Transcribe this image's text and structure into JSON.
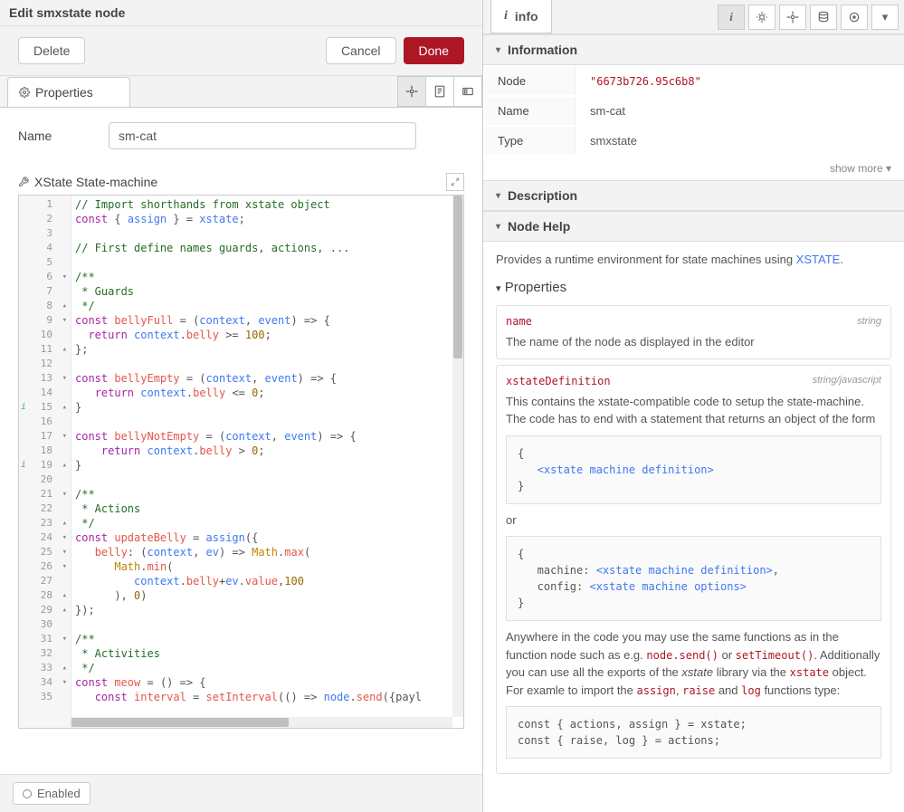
{
  "left": {
    "title": "Edit smxstate node",
    "delete_label": "Delete",
    "cancel_label": "Cancel",
    "done_label": "Done",
    "tab_label": "Properties",
    "name_label": "Name",
    "name_value": "sm-cat",
    "section_label": "XState State-machine",
    "enabled_label": "Enabled"
  },
  "code": {
    "lines": [
      {
        "n": 1,
        "fold": "",
        "text": "// Import shorthands from xstate object",
        "cls": "comment"
      },
      {
        "n": 2,
        "fold": "",
        "text": "const { assign } = xstate;"
      },
      {
        "n": 3,
        "fold": "",
        "text": ""
      },
      {
        "n": 4,
        "fold": "",
        "text": "// First define names guards, actions, ...",
        "cls": "comment"
      },
      {
        "n": 5,
        "fold": "",
        "text": ""
      },
      {
        "n": 6,
        "fold": "▾",
        "text": "/**",
        "cls": "comment"
      },
      {
        "n": 7,
        "fold": "",
        "text": " * Guards",
        "cls": "comment"
      },
      {
        "n": 8,
        "fold": "▴",
        "text": " */",
        "cls": "comment"
      },
      {
        "n": 9,
        "fold": "▾",
        "text": "const bellyFull = (context, event) => {"
      },
      {
        "n": 10,
        "fold": "",
        "text": "  return context.belly >= 100;"
      },
      {
        "n": 11,
        "fold": "▴",
        "text": "};"
      },
      {
        "n": 12,
        "fold": "",
        "text": ""
      },
      {
        "n": 13,
        "fold": "▾",
        "text": "const bellyEmpty = (context, event) => {"
      },
      {
        "n": 14,
        "fold": "",
        "text": "   return context.belly <= 0;"
      },
      {
        "n": 15,
        "fold": "▴",
        "mark": "i",
        "text": "}"
      },
      {
        "n": 16,
        "fold": "",
        "text": ""
      },
      {
        "n": 17,
        "fold": "▾",
        "text": "const bellyNotEmpty = (context, event) => {"
      },
      {
        "n": 18,
        "fold": "",
        "text": "    return context.belly > 0;"
      },
      {
        "n": 19,
        "fold": "▴",
        "mark": "i",
        "text": "}"
      },
      {
        "n": 20,
        "fold": "",
        "text": ""
      },
      {
        "n": 21,
        "fold": "▾",
        "text": "/**",
        "cls": "comment"
      },
      {
        "n": 22,
        "fold": "",
        "text": " * Actions",
        "cls": "comment"
      },
      {
        "n": 23,
        "fold": "▴",
        "text": " */",
        "cls": "comment"
      },
      {
        "n": 24,
        "fold": "▾",
        "text": "const updateBelly = assign({"
      },
      {
        "n": 25,
        "fold": "▾",
        "text": "   belly: (context, ev) => Math.max("
      },
      {
        "n": 26,
        "fold": "▾",
        "text": "      Math.min("
      },
      {
        "n": 27,
        "fold": "",
        "text": "         context.belly+ev.value,100"
      },
      {
        "n": 28,
        "fold": "▴",
        "text": "      ), 0)"
      },
      {
        "n": 29,
        "fold": "▴",
        "text": "});"
      },
      {
        "n": 30,
        "fold": "",
        "text": ""
      },
      {
        "n": 31,
        "fold": "▾",
        "text": "/**",
        "cls": "comment"
      },
      {
        "n": 32,
        "fold": "",
        "text": " * Activities",
        "cls": "comment"
      },
      {
        "n": 33,
        "fold": "▴",
        "text": " */",
        "cls": "comment"
      },
      {
        "n": 34,
        "fold": "▾",
        "text": "const meow = () => {"
      },
      {
        "n": 35,
        "fold": "",
        "text": "   const interval = setInterval(() => node.send({payl"
      }
    ]
  },
  "right": {
    "info_tab": "info",
    "information_header": "Information",
    "rows": {
      "node_label": "Node",
      "node_value": "\"6673b726.95c6b8\"",
      "name_label": "Name",
      "name_value": "sm-cat",
      "type_label": "Type",
      "type_value": "smxstate"
    },
    "show_more": "show more ▾",
    "description_header": "Description",
    "nodehelp_header": "Node Help",
    "help_intro1": "Provides a runtime environment for state machines using ",
    "help_intro_link": "XSTATE",
    "properties_head": "Properties",
    "props": [
      {
        "name": "name",
        "type": "string",
        "desc": "The name of the node as displayed in the editor"
      },
      {
        "name": "xstateDefinition",
        "type": "string/javascript",
        "desc": "This contains the xstate-compatible code to setup the state-machine. The code has to end with a statement that returns an object of the form"
      }
    ],
    "codeblock1_l1": "{",
    "codeblock1_l2": "   <xstate machine definition>",
    "codeblock1_l3": "}",
    "or_text": "or",
    "codeblock2_l1": "{",
    "codeblock2_l2": "   machine: <xstate machine definition>,",
    "codeblock2_l3": "   config: <xstate machine options>",
    "codeblock2_l4": "}",
    "para2_a": "Anywhere in the code you may use the same functions as in the function node such as e.g. ",
    "para2_code1": "node.send()",
    "para2_b": " or ",
    "para2_code2": "setTimeout()",
    "para2_c": ". Additionally you can use all the exports of the ",
    "para2_ital": "xstate",
    "para2_d": " library via the ",
    "para2_code3": "xstate",
    "para2_e": " object. For examle to import the ",
    "para2_code4": "assign",
    "para2_f": ", ",
    "para2_code5": "raise",
    "para2_g": " and ",
    "para2_code6": "log",
    "para2_h": " functions type:",
    "codeblock3_l1": "const { actions, assign } = xstate;",
    "codeblock3_l2": "const { raise, log } = actions;"
  }
}
